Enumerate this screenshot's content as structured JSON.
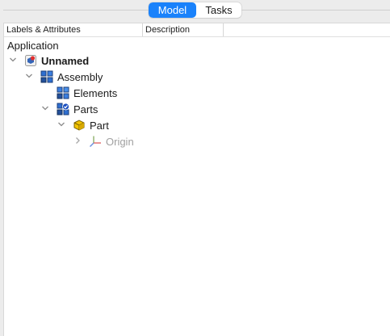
{
  "tabs": [
    {
      "label": "Model",
      "active": true
    },
    {
      "label": "Tasks",
      "active": false
    }
  ],
  "colors": {
    "accent": "#1a82fb",
    "dimmed_text": "#a0a0a0"
  },
  "tree_header": {
    "col_labels": "Labels & Attributes",
    "col_description": "Description"
  },
  "tree": {
    "root_label": "Application",
    "nodes": [
      {
        "label": "Unnamed",
        "icon": "document-icon",
        "expanded": true,
        "bold": true
      },
      {
        "label": "Assembly",
        "icon": "assembly-icon",
        "expanded": true
      },
      {
        "label": "Elements",
        "icon": "elements-icon"
      },
      {
        "label": "Parts",
        "icon": "parts-icon",
        "expanded": true
      },
      {
        "label": "Part",
        "icon": "part-icon",
        "expanded": true
      },
      {
        "label": "Origin",
        "icon": "origin-axes-icon",
        "expanded": false,
        "dimmed": true
      }
    ]
  }
}
